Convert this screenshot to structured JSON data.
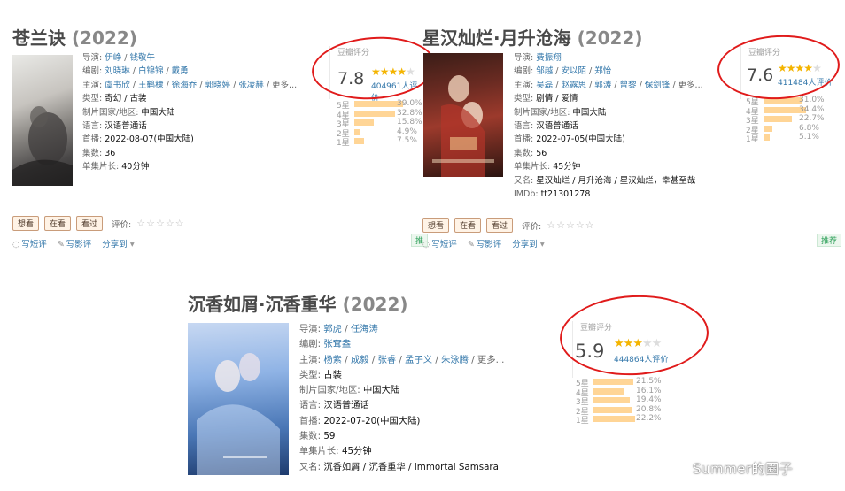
{
  "cards": [
    {
      "title": "苍兰诀",
      "year": "(2022)",
      "info": [
        {
          "k": "导演: ",
          "v": [
            "伊峥",
            "钱敬午"
          ],
          "link": true
        },
        {
          "k": "编剧: ",
          "v": [
            "刘晓琳",
            "白锦锦",
            "戴勇"
          ],
          "link": true
        },
        {
          "k": "主演: ",
          "v": [
            "虞书欣",
            "王鹤棣",
            "徐海乔",
            "郭晓婷",
            "张凌赫"
          ],
          "link": true,
          "more": " / 更多..."
        },
        {
          "k": "类型: ",
          "text": "奇幻 / 古装"
        },
        {
          "k": "制片国家/地区: ",
          "text": "中国大陆"
        },
        {
          "k": "语言: ",
          "text": "汉语普通话"
        },
        {
          "k": "首播: ",
          "text": "2022-08-07(中国大陆)"
        },
        {
          "k": "集数: ",
          "text": "36"
        },
        {
          "k": "单集片长: ",
          "text": "40分钟"
        }
      ],
      "rating": {
        "label": "豆瓣评分",
        "score": "7.8",
        "stars": 4,
        "count": "404961人评价",
        "dist": [
          {
            "star": "5星",
            "pct": "39.0%",
            "v": 39.0
          },
          {
            "star": "4星",
            "pct": "32.8%",
            "v": 32.8
          },
          {
            "star": "3星",
            "pct": "15.8%",
            "v": 15.8
          },
          {
            "star": "2星",
            "pct": "4.9%",
            "v": 4.9
          },
          {
            "star": "1星",
            "pct": "7.5%",
            "v": 7.5
          }
        ]
      },
      "buttons": [
        "想看",
        "在看",
        "看过"
      ],
      "rate_label": "评价:",
      "links": [
        "写短评",
        "写影评",
        "分享到"
      ]
    },
    {
      "title": "星汉灿烂·月升沧海",
      "year": "(2022)",
      "info": [
        {
          "k": "导演: ",
          "v": [
            "费振翔"
          ],
          "link": true
        },
        {
          "k": "编剧: ",
          "v": [
            "邹越",
            "安以陌",
            "郑怡"
          ],
          "link": true
        },
        {
          "k": "主演: ",
          "v": [
            "吴磊",
            "赵露思",
            "郭涛",
            "曾黎",
            "保剑锋"
          ],
          "link": true,
          "more": " / 更多..."
        },
        {
          "k": "类型: ",
          "text": "剧情 / 爱情"
        },
        {
          "k": "制片国家/地区: ",
          "text": "中国大陆"
        },
        {
          "k": "语言: ",
          "text": "汉语普通话"
        },
        {
          "k": "首播: ",
          "text": "2022-07-05(中国大陆)"
        },
        {
          "k": "集数: ",
          "text": "56"
        },
        {
          "k": "单集片长: ",
          "text": "45分钟"
        },
        {
          "k": "又名: ",
          "text": "星汉灿烂 / 月升沧海 / 星汉灿烂，幸甚至哉"
        },
        {
          "k": "IMDb: ",
          "text": "tt21301278"
        }
      ],
      "rating": {
        "label": "豆瓣评分",
        "score": "7.6",
        "stars": 4,
        "count": "411484人评价",
        "dist": [
          {
            "star": "5星",
            "pct": "31.0%",
            "v": 31.0
          },
          {
            "star": "4星",
            "pct": "34.4%",
            "v": 34.4
          },
          {
            "star": "3星",
            "pct": "22.7%",
            "v": 22.7
          },
          {
            "star": "2星",
            "pct": "6.8%",
            "v": 6.8
          },
          {
            "star": "1星",
            "pct": "5.1%",
            "v": 5.1
          }
        ]
      },
      "buttons": [
        "想看",
        "在看",
        "看过"
      ],
      "rate_label": "评价:",
      "links": [
        "写短评",
        "写影评",
        "分享到"
      ],
      "recommend": "推荐"
    },
    {
      "title": "沉香如屑·沉香重华",
      "year": "(2022)",
      "info": [
        {
          "k": "导演: ",
          "v": [
            "郭虎",
            "任海涛"
          ],
          "link": true
        },
        {
          "k": "编剧: ",
          "v": [
            "张耷盎"
          ],
          "link": true
        },
        {
          "k": "主演: ",
          "v": [
            "杨紫",
            "成毅",
            "张睿",
            "孟子义",
            "朱泳腾"
          ],
          "link": true,
          "more": " / 更多..."
        },
        {
          "k": "类型: ",
          "text": "古装"
        },
        {
          "k": "制片国家/地区: ",
          "text": "中国大陆"
        },
        {
          "k": "语言: ",
          "text": "汉语普通话"
        },
        {
          "k": "首播: ",
          "text": "2022-07-20(中国大陆)"
        },
        {
          "k": "集数: ",
          "text": "59"
        },
        {
          "k": "单集片长: ",
          "text": "45分钟"
        },
        {
          "k": "又名: ",
          "text": "沉香如屑 / 沉香重华 / Immortal Samsara"
        }
      ],
      "rating": {
        "label": "豆瓣评分",
        "score": "5.9",
        "stars": 3,
        "count": "444864人评价",
        "dist": [
          {
            "star": "5星",
            "pct": "21.5%",
            "v": 21.5
          },
          {
            "star": "4星",
            "pct": "16.1%",
            "v": 16.1
          },
          {
            "star": "3星",
            "pct": "19.4%",
            "v": 19.4
          },
          {
            "star": "2星",
            "pct": "20.8%",
            "v": 20.8
          },
          {
            "star": "1星",
            "pct": "22.2%",
            "v": 22.2
          }
        ]
      }
    }
  ],
  "first_recommend": "推",
  "watermark": "Summer的圈子",
  "colors": {
    "link": "#3377aa",
    "bar": "#ffd596",
    "star": "#f4b400",
    "circle": "#e01b1b"
  }
}
